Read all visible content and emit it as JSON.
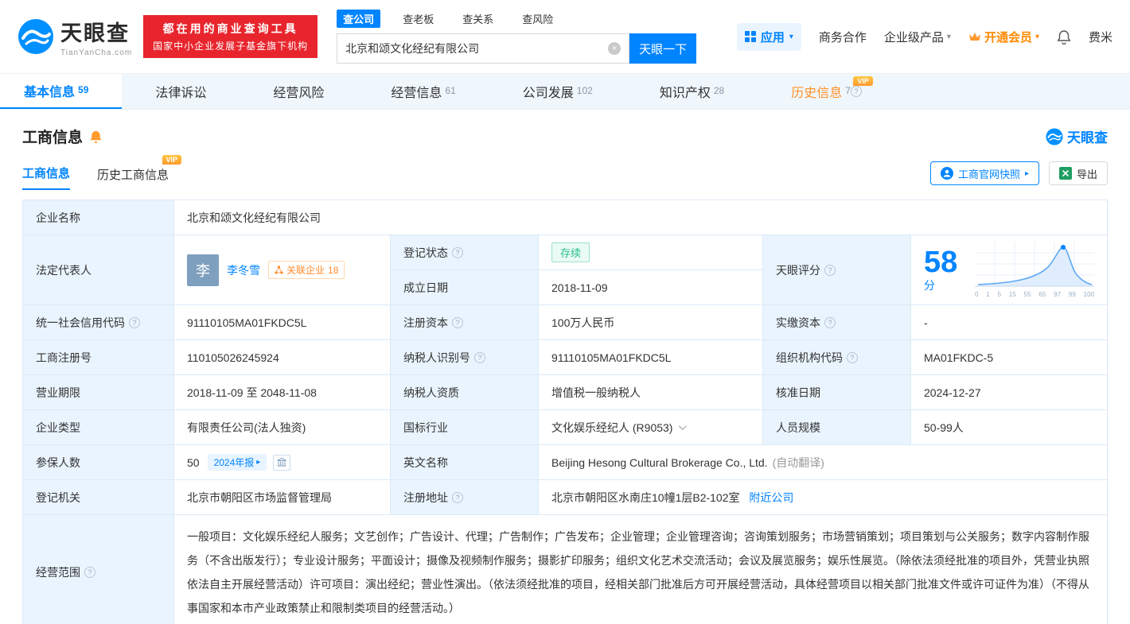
{
  "header": {
    "logo_text": "天眼查",
    "logo_sub": "TianYanCha.com",
    "promo_line1": "都在用的商业查询工具",
    "promo_line2": "国家中小企业发展子基金旗下机构",
    "search_tabs": [
      "查公司",
      "查老板",
      "查关系",
      "查风险"
    ],
    "search_value": "北京和颂文化经纪有限公司",
    "search_button": "天眼一下",
    "nav": {
      "apps": "应用",
      "cooperation": "商务合作",
      "enterprise": "企业级产品",
      "vip": "开通会员",
      "user": "费米"
    }
  },
  "vip_badge": "VIP",
  "tabs": [
    {
      "label": "基本信息",
      "count": "59"
    },
    {
      "label": "法律诉讼",
      "count": ""
    },
    {
      "label": "经营风险",
      "count": ""
    },
    {
      "label": "经营信息",
      "count": "61"
    },
    {
      "label": "公司发展",
      "count": "102"
    },
    {
      "label": "知识产权",
      "count": "28"
    },
    {
      "label": "历史信息",
      "count": "7"
    }
  ],
  "section": {
    "title": "工商信息",
    "logo": "天眼查",
    "subtab_current": "工商信息",
    "subtab_history": "历史工商信息",
    "snapshot_button": "工商官网快照",
    "export_button": "导出"
  },
  "fields": {
    "company_name": {
      "label": "企业名称",
      "value": "北京和颂文化经纪有限公司"
    },
    "legal_rep": {
      "label": "法定代表人",
      "avatar": "李",
      "name": "李冬雪",
      "related": "关联企业",
      "related_count": "18"
    },
    "reg_status": {
      "label": "登记状态",
      "value": "存续"
    },
    "est_date": {
      "label": "成立日期",
      "value": "2018-11-09"
    },
    "score": {
      "label": "天眼评分",
      "value": "58",
      "unit": "分",
      "axis": [
        "0",
        "1",
        "5",
        "15",
        "55",
        "65",
        "97",
        "99",
        "100"
      ]
    },
    "credit_code": {
      "label": "统一社会信用代码",
      "value": "91110105MA01FKDC5L"
    },
    "reg_capital": {
      "label": "注册资本",
      "value": "100万人民币"
    },
    "paid_capital": {
      "label": "实缴资本",
      "value": "-"
    },
    "reg_number": {
      "label": "工商注册号",
      "value": "110105026245924"
    },
    "taxpayer_id": {
      "label": "纳税人识别号",
      "value": "91110105MA01FKDC5L"
    },
    "org_code": {
      "label": "组织机构代码",
      "value": "MA01FKDC-5"
    },
    "biz_term": {
      "label": "营业期限",
      "value": "2018-11-09 至 2048-11-08"
    },
    "taxpayer_quality": {
      "label": "纳税人资质",
      "value": "增值税一般纳税人"
    },
    "approval_date": {
      "label": "核准日期",
      "value": "2024-12-27"
    },
    "company_type": {
      "label": "企业类型",
      "value": "有限责任公司(法人独资)"
    },
    "industry": {
      "label": "国标行业",
      "value": "文化娱乐经纪人 (R9053)"
    },
    "staff_size": {
      "label": "人员规模",
      "value": "50-99人"
    },
    "insured": {
      "label": "参保人数",
      "value": "50",
      "badge": "2024年报"
    },
    "english_name": {
      "label": "英文名称",
      "value": "Beijing Hesong Cultural Brokerage Co., Ltd.",
      "note": "(自动翻译)"
    },
    "reg_authority": {
      "label": "登记机关",
      "value": "北京市朝阳区市场监督管理局"
    },
    "reg_address": {
      "label": "注册地址",
      "value": "北京市朝阳区水南庄10幢1层B2-102室",
      "link": "附近公司"
    },
    "business_scope": {
      "label": "经营范围",
      "value": "一般项目：文化娱乐经纪人服务；文艺创作；广告设计、代理；广告制作；广告发布；企业管理；企业管理咨询；咨询策划服务；市场营销策划；项目策划与公关服务；数字内容制作服务（不含出版发行）；专业设计服务；平面设计；摄像及视频制作服务；摄影扩印服务；组织文化艺术交流活动；会议及展览服务；娱乐性展览。（除依法须经批准的项目外，凭营业执照依法自主开展经营活动）许可项目：演出经纪；营业性演出。（依法须经批准的项目，经相关部门批准后方可开展经营活动，具体经营项目以相关部门批准文件或许可证件为准）（不得从事国家和本市产业政策禁止和限制类项目的经营活动。）"
    }
  }
}
